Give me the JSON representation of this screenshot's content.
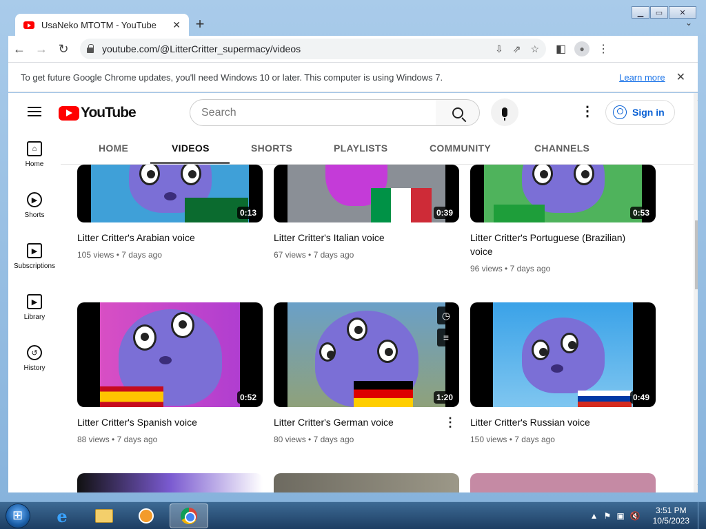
{
  "browser": {
    "tab_title": "UsaNeko MTOTM - YouTube",
    "tab_close": "✕",
    "new_tab": "+",
    "tab_list": "⌄",
    "url": "youtube.com/@LitterCritter_supermacy/videos",
    "back": "←",
    "forward": "→",
    "reload": "↻",
    "infobar_text": "To get future Google Chrome updates, you'll need Windows 10 or later. This computer is using Windows 7.",
    "infobar_link": "Learn more",
    "infobar_close": "✕"
  },
  "youtube": {
    "logo_text": "YouTube",
    "search_placeholder": "Search",
    "sign_in": "Sign in",
    "more": "⋮",
    "guide": [
      {
        "label": "Home"
      },
      {
        "label": "Shorts"
      },
      {
        "label": "Subscriptions"
      },
      {
        "label": "Library"
      },
      {
        "label": "History"
      }
    ],
    "tabs": [
      {
        "label": "HOME"
      },
      {
        "label": "VIDEOS"
      },
      {
        "label": "SHORTS"
      },
      {
        "label": "PLAYLISTS"
      },
      {
        "label": "COMMUNITY"
      },
      {
        "label": "CHANNELS"
      }
    ],
    "active_tab": "VIDEOS",
    "tabs_next": "›",
    "videos": [
      {
        "title": "Litter Critter's Arabian voice",
        "duration": "0:13",
        "views": "105 views",
        "age": "7 days ago"
      },
      {
        "title": "Litter Critter's Italian voice",
        "duration": "0:39",
        "views": "67 views",
        "age": "7 days ago"
      },
      {
        "title": "Litter Critter's Portuguese (Brazilian) voice",
        "duration": "0:53",
        "views": "96 views",
        "age": "7 days ago"
      },
      {
        "title": "Litter Critter's Spanish voice",
        "duration": "0:52",
        "views": "88 views",
        "age": "7 days ago"
      },
      {
        "title": "Litter Critter's German voice",
        "duration": "1:20",
        "views": "80 views",
        "age": "7 days ago"
      },
      {
        "title": "Litter Critter's Russian voice",
        "duration": "0:49",
        "views": "150 views",
        "age": "7 days ago"
      }
    ],
    "meta_separator": "•"
  },
  "taskbar": {
    "time": "3:51 PM",
    "date": "10/5/2023"
  }
}
